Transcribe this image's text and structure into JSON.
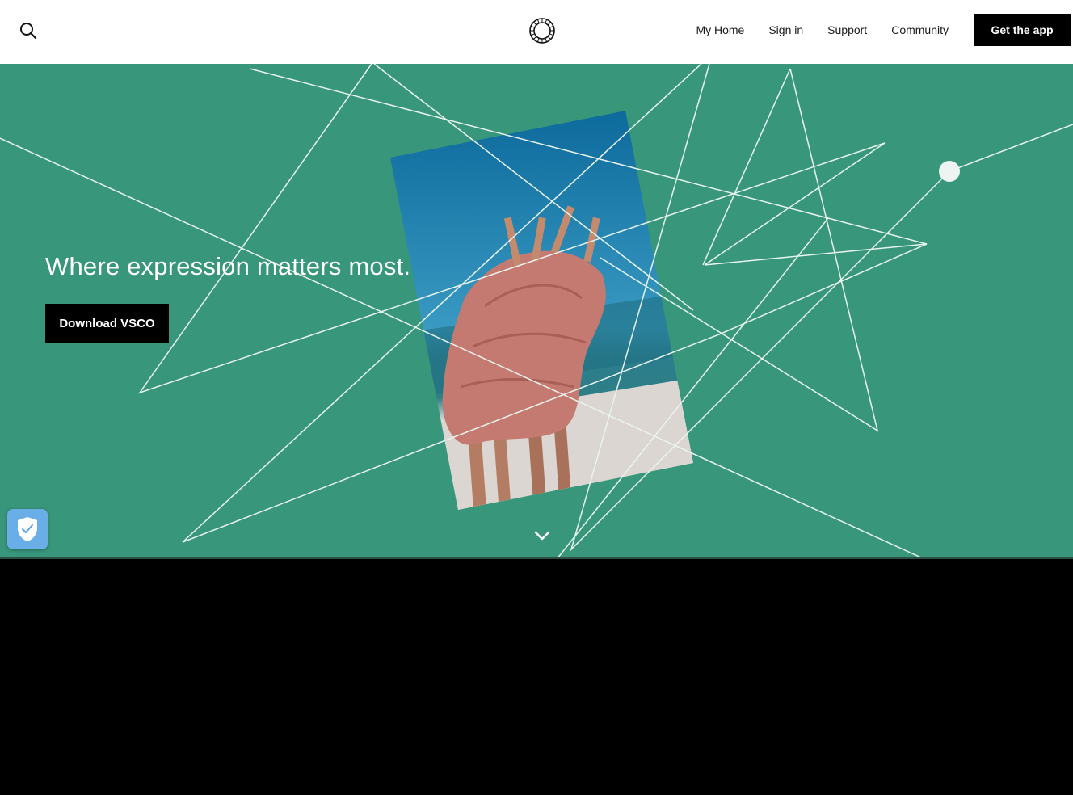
{
  "nav": {
    "search_icon": "search-icon",
    "logo_icon": "vsco-ring-logo",
    "links": [
      "My Home",
      "Sign in",
      "Support",
      "Community"
    ],
    "cta_label": "Get the app"
  },
  "hero": {
    "background_color": "#38967b",
    "headline": "Where expression matters most.",
    "download_label": "Download VSCO",
    "photo": "photo of two people wrapped in pink fabric on a beach",
    "scroll_icon": "chevron-down-icon"
  },
  "widget": {
    "icon": "shield-check-icon",
    "color": "#6aaee8"
  }
}
